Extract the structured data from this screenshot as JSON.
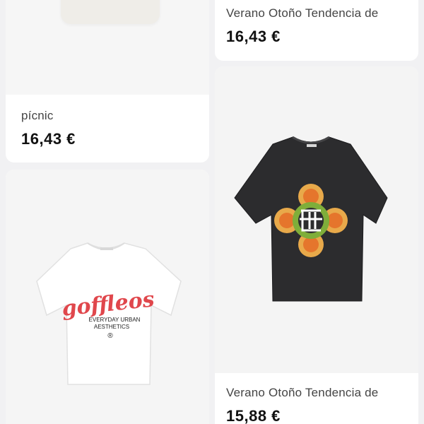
{
  "products": [
    {
      "title": "pícnic",
      "price": "16,43 €",
      "image": "basket-image"
    },
    {
      "title": "Verano Otoño Tendencia de",
      "price": "16,43 €"
    },
    {
      "title": "",
      "price": "",
      "image": "white-tshirt-image",
      "print": {
        "script": "goffleos",
        "line1": "EVERYDAY URBAN",
        "line2": "AESTHETICS",
        "mark": "®"
      },
      "accent": "#e0474c"
    },
    {
      "title": "Verano Otoño Tendencia de",
      "price": "15,88 €",
      "image": "black-tshirt-image",
      "accent": "#e5752c"
    }
  ],
  "colors": {
    "page_bg": "#f1f1f3",
    "card_bg": "#ffffff",
    "title": "#444444",
    "price": "#111111"
  }
}
